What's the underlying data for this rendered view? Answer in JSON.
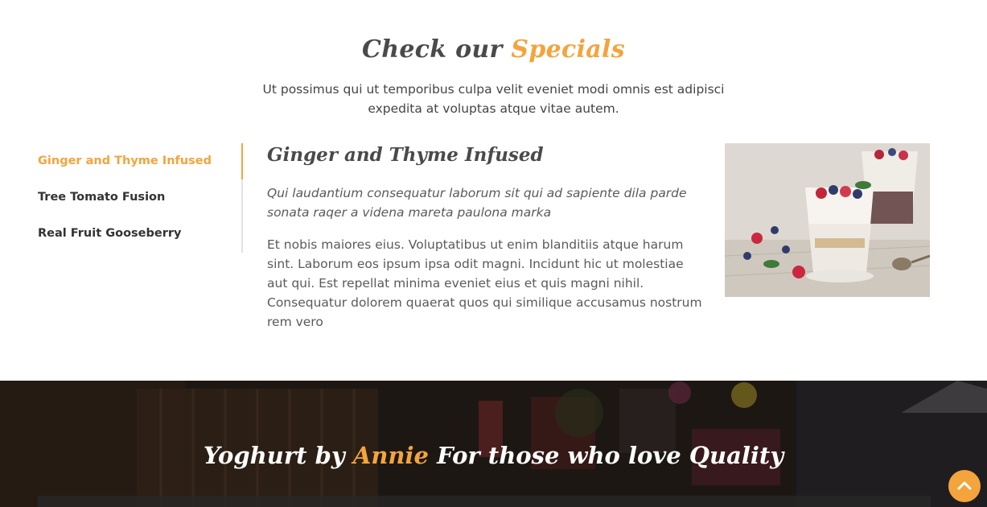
{
  "specials": {
    "title_part1": "Check our",
    "title_part2": "Specials",
    "subtitle": "Ut possimus qui ut temporibus culpa velit eveniet modi omnis est adipisci expedita at voluptas atque vitae autem.",
    "tabs": [
      {
        "label": "Ginger and Thyme Infused",
        "active": true
      },
      {
        "label": "Tree Tomato Fusion",
        "active": false
      },
      {
        "label": "Real Fruit Gooseberry",
        "active": false
      }
    ],
    "detail": {
      "heading": "Ginger and Thyme Infused",
      "lead": "Qui laudantium consequatur laborum sit qui ad sapiente dila parde sonata raqer a videna mareta paulona marka",
      "body": "Et nobis maiores eius. Voluptatibus ut enim blanditiis atque harum sint. Laborum eos ipsum ipsa odit magni. Incidunt hic ut molestiae aut qui. Est repellat minima eveniet eius et quis magni nihil. Consequatur dolorem quaerat quos qui similique accusamus nostrum rem vero"
    },
    "photo_icon": "yoghurt-berries-photo"
  },
  "banner": {
    "title_part1": "Yoghurt by",
    "title_part2": "Annie",
    "title_part3": "For those who love Quality"
  },
  "back_to_top": {
    "icon": "chevron-up-icon"
  },
  "colors": {
    "accent": "#f4a43d",
    "heading": "#4a4a4a",
    "text": "#5a5a5a",
    "divider": "#e2e2e2"
  }
}
